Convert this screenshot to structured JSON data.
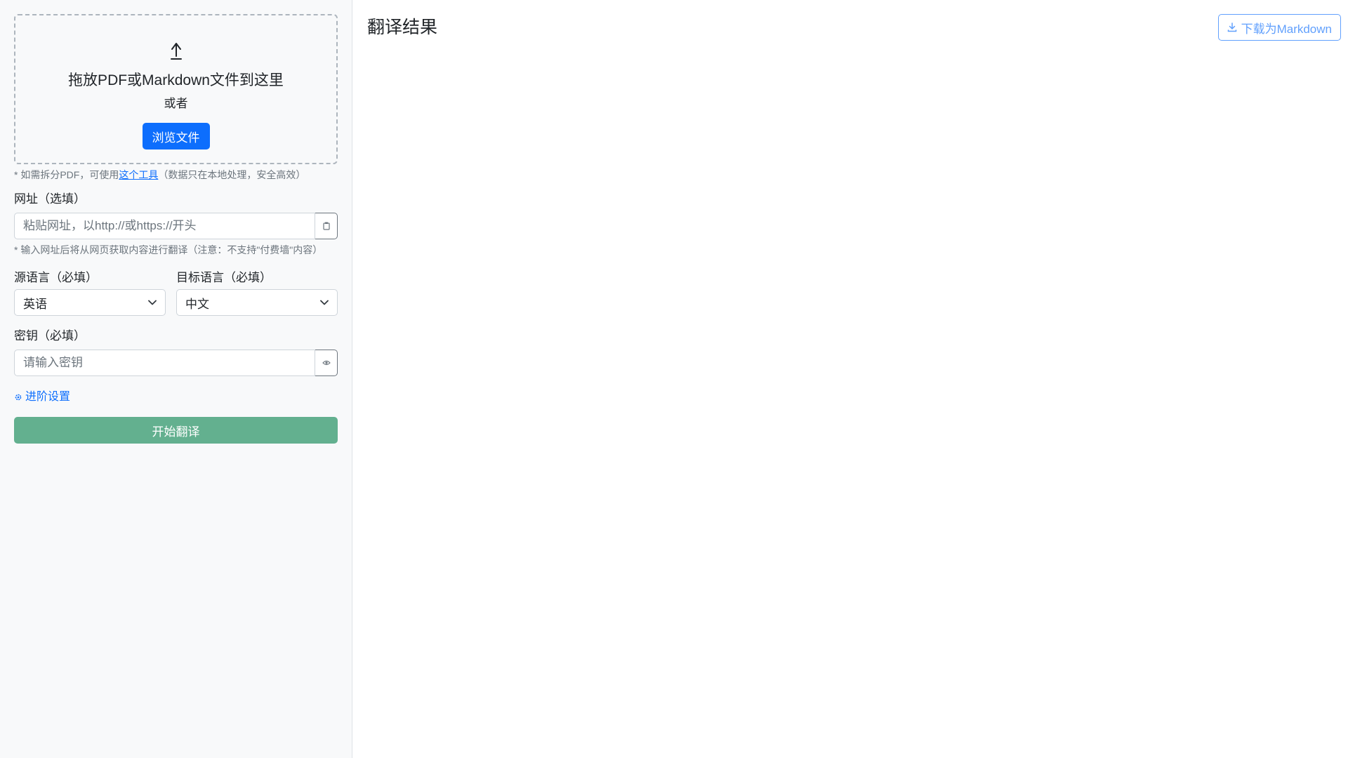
{
  "upload": {
    "title": "拖放PDF或Markdown文件到这里",
    "or": "或者",
    "browse_label": "浏览文件"
  },
  "pdf_hint": {
    "prefix": "* 如需拆分PDF，可使用",
    "link_text": "这个工具",
    "suffix": "（数据只在本地处理，安全高效）"
  },
  "url": {
    "label": "网址（选填）",
    "placeholder": "粘贴网址，以http://或https://开头",
    "hint": "* 输入网址后将从网页获取内容进行翻译（注意：不支持\"付费墙\"内容）"
  },
  "source_lang": {
    "label": "源语言（必填）",
    "value": "英语"
  },
  "target_lang": {
    "label": "目标语言（必填）",
    "value": "中文"
  },
  "api_key": {
    "label": "密钥（必填）",
    "placeholder": "请输入密钥"
  },
  "advanced_label": "进阶设置",
  "start_label": "开始翻译",
  "result": {
    "title": "翻译结果",
    "download_label": "下载为Markdown"
  },
  "icons": {
    "upload": "cloud-upload-icon",
    "url_action": "clipboard-icon",
    "key_action": "eye-icon",
    "advanced": "gear-icon",
    "download": "download-icon"
  },
  "colors": {
    "primary": "#0d6efd",
    "start_button": "#63b08f",
    "sidebar_bg": "#f8f9fa"
  }
}
